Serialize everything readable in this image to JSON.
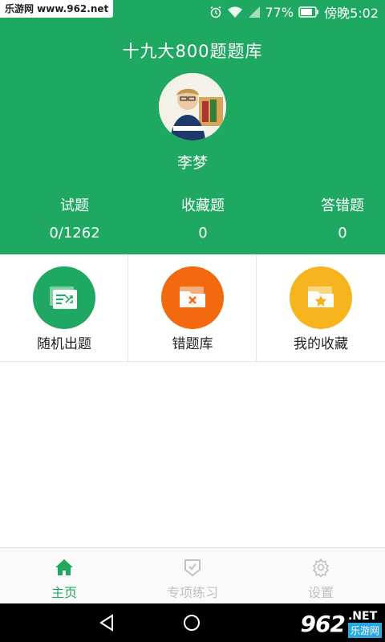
{
  "watermark_top": "乐游网 www.962.net",
  "status": {
    "battery": "77%",
    "time": "傍晚5:02"
  },
  "app_title": "十九大800题题库",
  "user": {
    "name": "李梦"
  },
  "stats": [
    {
      "label": "试题",
      "value": "0/1262"
    },
    {
      "label": "收藏题",
      "value": "0"
    },
    {
      "label": "答错题",
      "value": "0"
    }
  ],
  "features": [
    {
      "label": "随机出题",
      "color": "#1fa862",
      "icon": "shuffle-icon"
    },
    {
      "label": "错题库",
      "color": "#f26a0d",
      "icon": "folder-x-icon"
    },
    {
      "label": "我的收藏",
      "color": "#f6b51e",
      "icon": "folder-star-icon"
    }
  ],
  "tabs": [
    {
      "label": "主页",
      "active": true,
      "icon": "home-icon"
    },
    {
      "label": "专项练习",
      "active": false,
      "icon": "shield-check-icon"
    },
    {
      "label": "设置",
      "active": false,
      "icon": "gear-icon"
    }
  ],
  "colors": {
    "primary": "#1fa862",
    "tab_inactive": "#c0c0c0"
  },
  "watermark_bottom": {
    "logo": "962",
    "net": ".NET",
    "sub": "乐游网"
  }
}
